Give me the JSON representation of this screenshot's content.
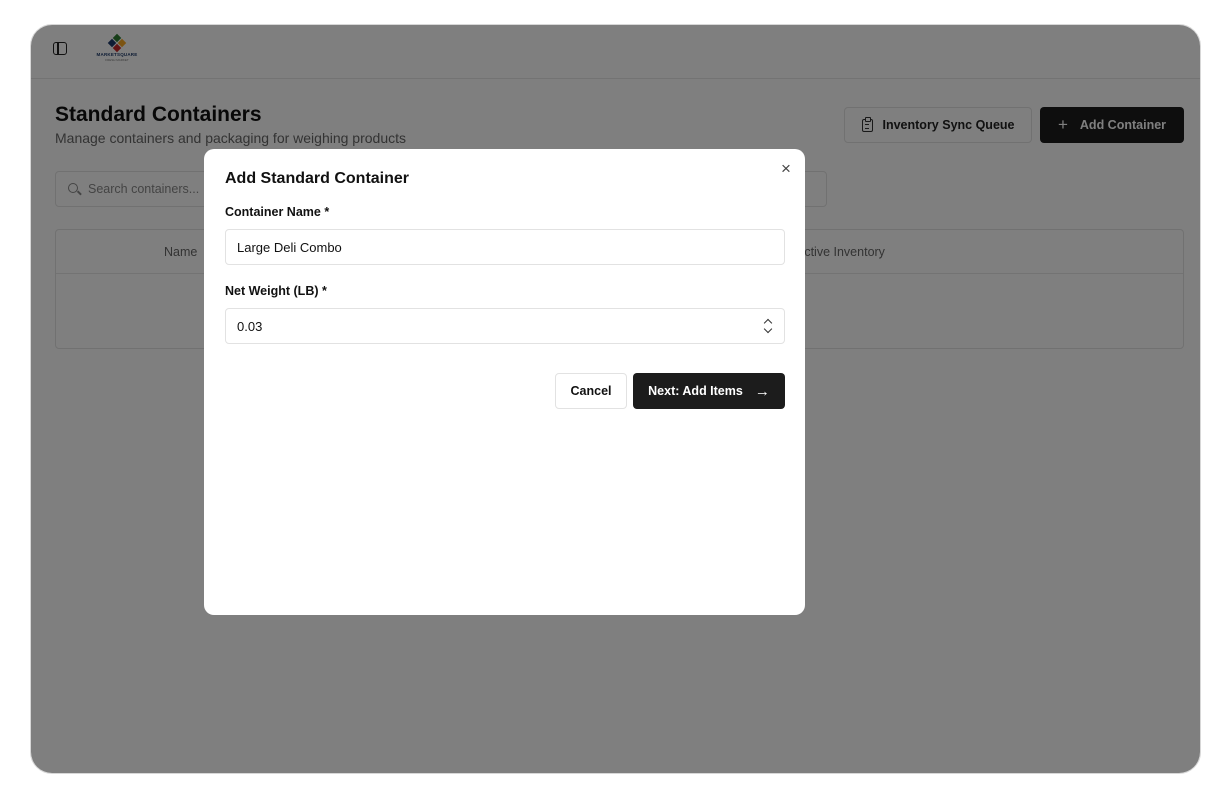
{
  "app": {
    "logo_text": "MARKETSQUARE",
    "logo_subtext": "FRESH MARKET",
    "logo_colors": [
      "#2e7d32",
      "#f9a825",
      "#c62828",
      "#1e3a6a"
    ]
  },
  "page": {
    "title": "Standard Containers",
    "subtitle": "Manage containers and packaging for weighing products"
  },
  "toolbar": {
    "sync_label": "Inventory Sync Queue",
    "add_label": "Add Container",
    "add_icon": "+"
  },
  "search": {
    "placeholder": "Search containers..."
  },
  "table": {
    "columns": [
      "Name",
      "Active Inventory"
    ]
  },
  "dialog": {
    "title": "Add Standard Container",
    "close_icon": "×",
    "fields": [
      {
        "label": "Container Name *",
        "value": "Large Deli Combo"
      },
      {
        "label": "Net Weight (LB) *",
        "value": "0.03"
      }
    ],
    "cancel_label": "Cancel",
    "next_label": "Next: Add Items",
    "next_icon": "→"
  },
  "colors": {
    "primary_button": "#1c1c1c",
    "overlay": "rgba(0,0,0,0.5)"
  }
}
